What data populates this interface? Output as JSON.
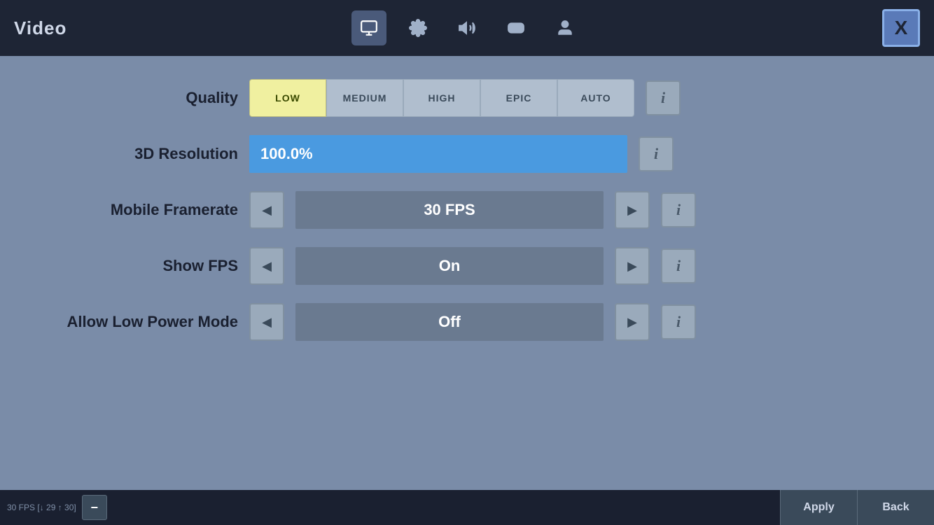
{
  "header": {
    "title": "Video",
    "close_label": "X",
    "nav_icons": [
      {
        "id": "monitor",
        "label": "monitor-icon",
        "active": true,
        "symbol": "🖥"
      },
      {
        "id": "settings",
        "label": "settings-icon",
        "active": false,
        "symbol": "⚙"
      },
      {
        "id": "audio",
        "label": "audio-icon",
        "active": false,
        "symbol": "🔊"
      },
      {
        "id": "gamepad",
        "label": "gamepad-icon",
        "active": false,
        "symbol": "🎮"
      },
      {
        "id": "user",
        "label": "user-icon",
        "active": false,
        "symbol": "👤"
      }
    ]
  },
  "settings": {
    "quality": {
      "label": "Quality",
      "options": [
        "LOW",
        "MEDIUM",
        "HIGH",
        "EPIC",
        "AUTO"
      ],
      "active_index": 0
    },
    "resolution": {
      "label": "3D Resolution",
      "value": "100.0%"
    },
    "framerate": {
      "label": "Mobile Framerate",
      "value": "30 FPS"
    },
    "show_fps": {
      "label": "Show FPS",
      "value": "On"
    },
    "low_power": {
      "label": "Allow Low Power Mode",
      "value": "Off"
    }
  },
  "footer": {
    "fps_text": "30 FPS [↓ 29 ↑ 30]",
    "minus_label": "−",
    "apply_label": "Apply",
    "back_label": "Back"
  },
  "info_button_label": "i"
}
